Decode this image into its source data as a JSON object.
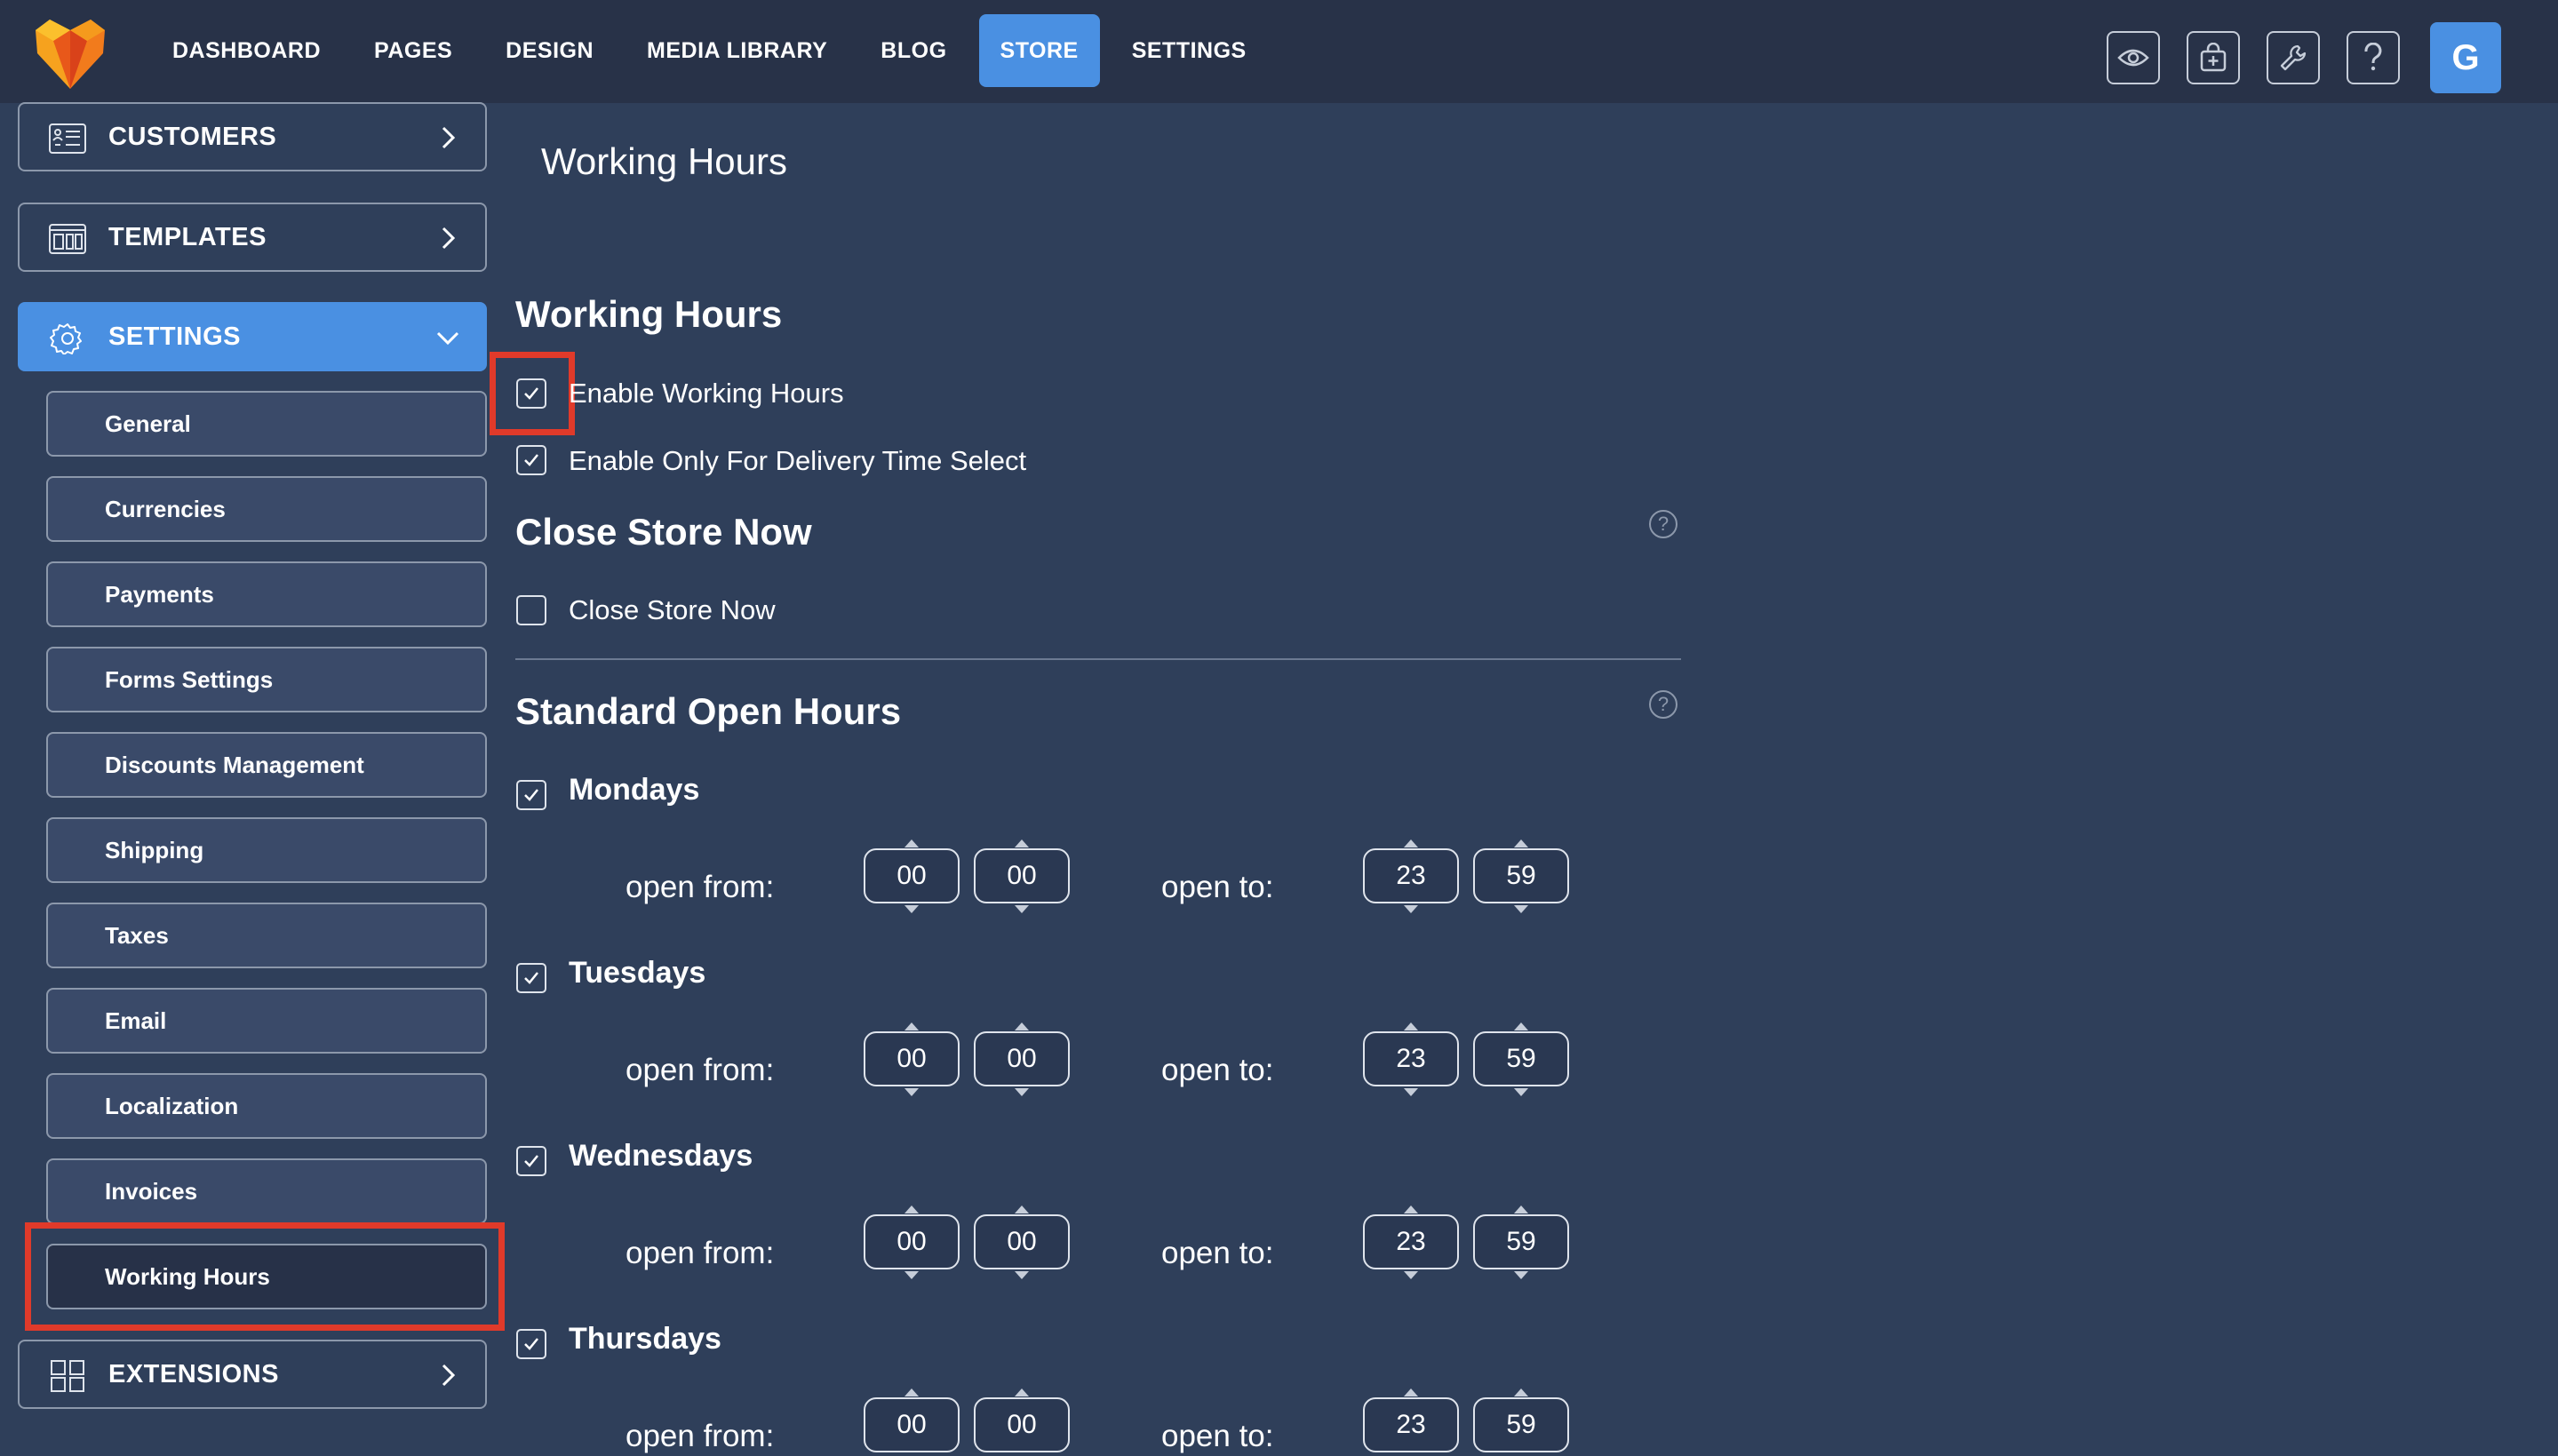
{
  "nav": {
    "items": [
      {
        "label": "DASHBOARD"
      },
      {
        "label": "PAGES"
      },
      {
        "label": "DESIGN"
      },
      {
        "label": "MEDIA LIBRARY"
      },
      {
        "label": "BLOG"
      },
      {
        "label": "STORE",
        "active": true
      },
      {
        "label": "SETTINGS"
      }
    ],
    "tool_icons": [
      "eye-icon",
      "store-bag-icon",
      "wrench-icon",
      "help-icon"
    ],
    "avatar_letter": "G"
  },
  "sidebar": {
    "customers": "CUSTOMERS",
    "templates": "TEMPLATES",
    "settings": "SETTINGS",
    "extensions": "EXTENSIONS",
    "settings_items": [
      "General",
      "Currencies",
      "Payments",
      "Forms Settings",
      "Discounts Management",
      "Shipping",
      "Taxes",
      "Email",
      "Localization",
      "Invoices",
      "Working Hours"
    ],
    "selected_item": "Working Hours"
  },
  "main": {
    "page_title": "Working Hours",
    "working_hours": {
      "heading": "Working Hours",
      "enable_label": "Enable Working Hours",
      "enable_checked": true,
      "delivery_label": "Enable Only For Delivery Time Select",
      "delivery_checked": true
    },
    "close_store": {
      "heading": "Close Store Now",
      "label": "Close Store Now",
      "checked": false
    },
    "standard_hours": {
      "heading": "Standard Open Hours",
      "open_from_label": "open from:",
      "open_to_label": "open to:",
      "days": [
        {
          "name": "Mondays",
          "checked": true,
          "from_h": "00",
          "from_m": "00",
          "to_h": "23",
          "to_m": "59"
        },
        {
          "name": "Tuesdays",
          "checked": true,
          "from_h": "00",
          "from_m": "00",
          "to_h": "23",
          "to_m": "59"
        },
        {
          "name": "Wednesdays",
          "checked": true,
          "from_h": "00",
          "from_m": "00",
          "to_h": "23",
          "to_m": "59"
        },
        {
          "name": "Thursdays",
          "checked": true,
          "from_h": "00",
          "from_m": "00",
          "to_h": "23",
          "to_m": "59"
        }
      ]
    },
    "help_glyph": "?"
  },
  "colors": {
    "page_bg": "#2f3f5a",
    "topbar_bg": "#283248",
    "accent": "#4a90e2",
    "highlight": "#e03a2a"
  }
}
